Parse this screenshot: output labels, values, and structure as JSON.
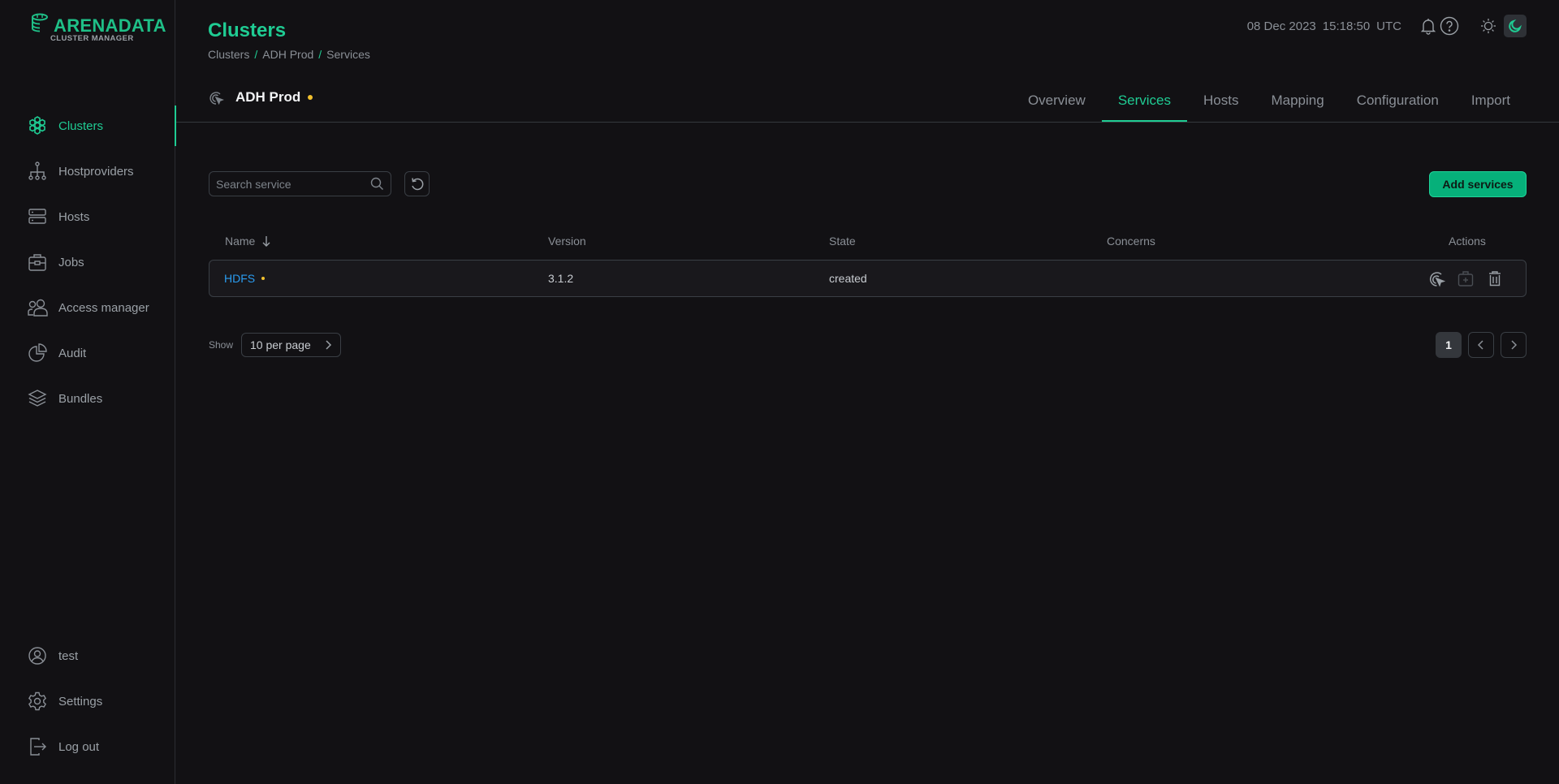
{
  "app": {
    "logo_title": "ARENADATA",
    "logo_subtitle": "CLUSTER MANAGER",
    "accent_color": "#1fcc93"
  },
  "sidebar": {
    "items": [
      {
        "label": "Clusters",
        "icon": "clusters-icon",
        "active": true
      },
      {
        "label": "Hostproviders",
        "icon": "hostproviders-icon"
      },
      {
        "label": "Hosts",
        "icon": "hosts-icon"
      },
      {
        "label": "Jobs",
        "icon": "jobs-icon"
      },
      {
        "label": "Access manager",
        "icon": "access-manager-icon"
      },
      {
        "label": "Audit",
        "icon": "audit-icon"
      },
      {
        "label": "Bundles",
        "icon": "bundles-icon"
      }
    ],
    "bottom_items": [
      {
        "label": "test",
        "icon": "user-icon"
      },
      {
        "label": "Settings",
        "icon": "gear-icon"
      },
      {
        "label": "Log out",
        "icon": "logout-icon"
      }
    ]
  },
  "header": {
    "title": "Clusters",
    "breadcrumb": [
      "Clusters",
      "ADH Prod",
      "Services"
    ],
    "breadcrumb_separator": "/",
    "date": "08 Dec 2023",
    "time": "15:18:50",
    "timezone": "UTC",
    "theme": "dark"
  },
  "cluster": {
    "name": "ADH Prod",
    "status_color": "#f2c12e"
  },
  "tabs": [
    {
      "label": "Overview"
    },
    {
      "label": "Services",
      "active": true
    },
    {
      "label": "Hosts"
    },
    {
      "label": "Mapping"
    },
    {
      "label": "Configuration"
    },
    {
      "label": "Import"
    }
  ],
  "toolbar": {
    "search_placeholder": "Search service",
    "search_value": "",
    "add_button_label": "Add services"
  },
  "table": {
    "columns": {
      "name": "Name",
      "version": "Version",
      "state": "State",
      "concerns": "Concerns",
      "actions": "Actions"
    },
    "sort": {
      "column": "name",
      "direction": "desc"
    },
    "rows": [
      {
        "name": "HDFS",
        "version": "3.1.2",
        "state": "created",
        "concerns": "",
        "status_color": "#f2c12e"
      }
    ]
  },
  "pagination": {
    "show_label": "Show",
    "per_page": "10 per page",
    "current_page": "1"
  }
}
